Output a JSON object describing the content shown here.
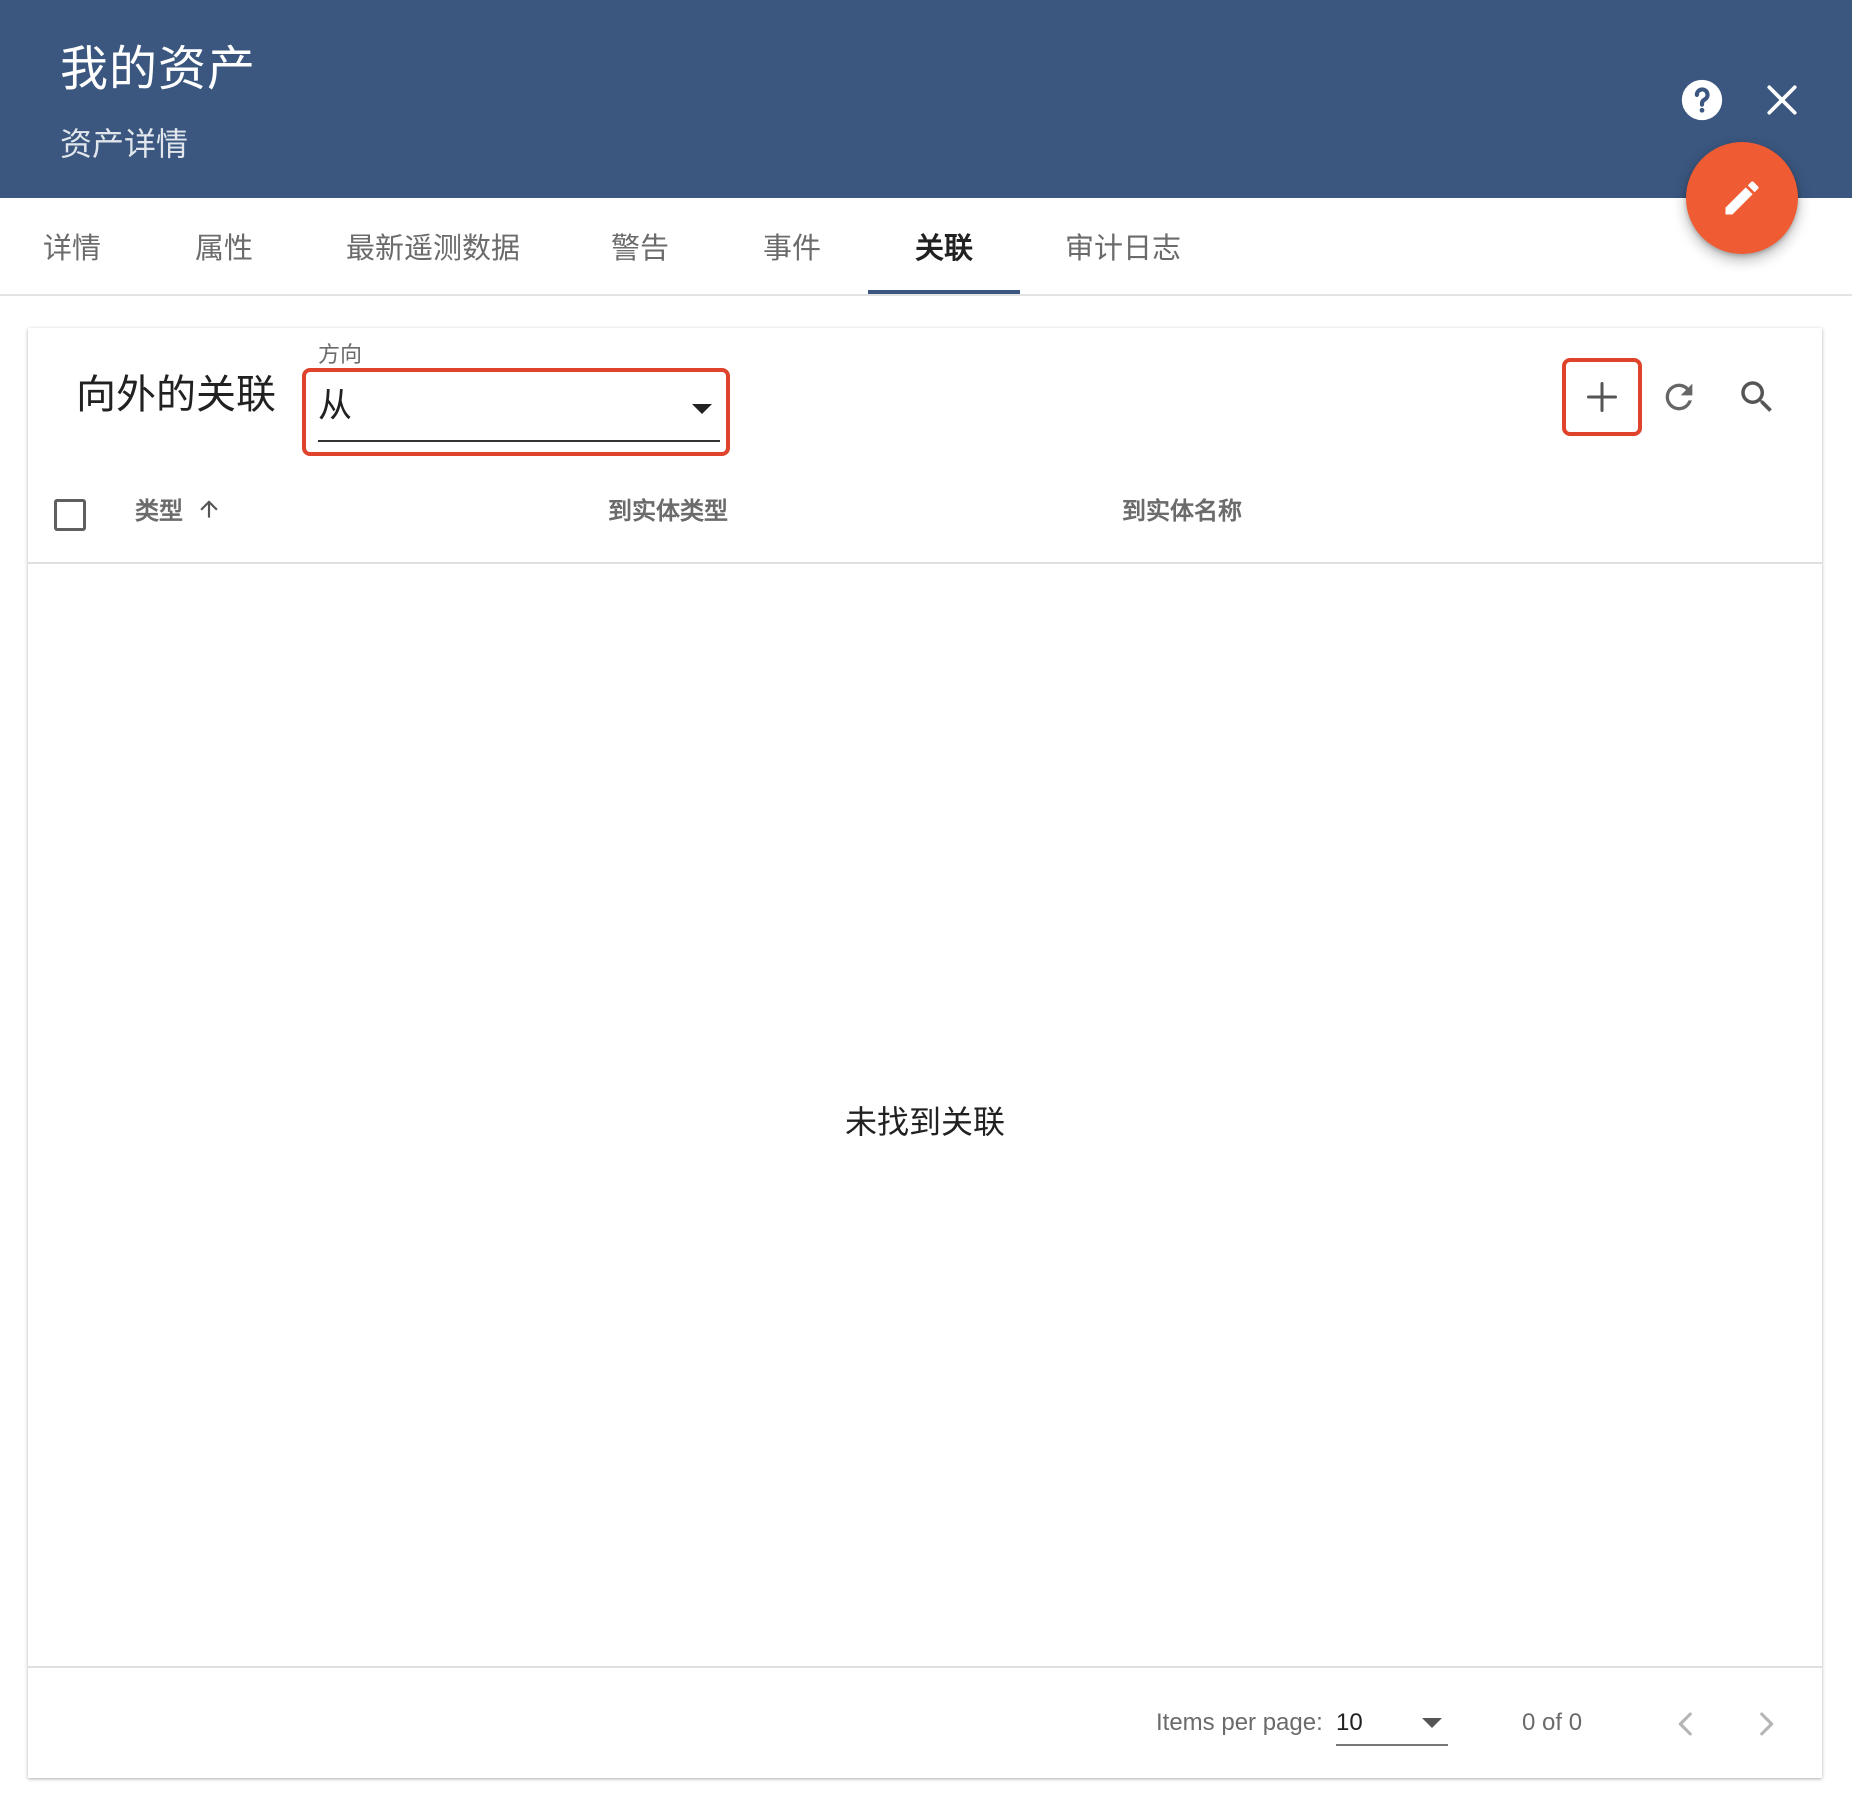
{
  "header": {
    "title": "我的资产",
    "subtitle": "资产详情",
    "help_icon": "help-circle-icon",
    "close_icon": "close-icon",
    "edit_icon": "pencil-icon"
  },
  "tabs": [
    {
      "label": "详情"
    },
    {
      "label": "属性"
    },
    {
      "label": "最新遥测数据"
    },
    {
      "label": "警告"
    },
    {
      "label": "事件"
    },
    {
      "label": "关联",
      "active": true
    },
    {
      "label": "审计日志"
    }
  ],
  "relations": {
    "title": "向外的关联",
    "direction_label": "方向",
    "direction_value": "从",
    "columns": {
      "type": "类型",
      "to_entity_type": "到实体类型",
      "to_entity_name": "到实体名称"
    },
    "empty_message": "未找到关联"
  },
  "paginator": {
    "items_per_page_label": "Items per page:",
    "items_per_page_value": "10",
    "range_label": "0 of 0"
  },
  "colors": {
    "header_bg": "#3b577f",
    "fab": "#ef5b33",
    "highlight_border": "#e0432b"
  }
}
